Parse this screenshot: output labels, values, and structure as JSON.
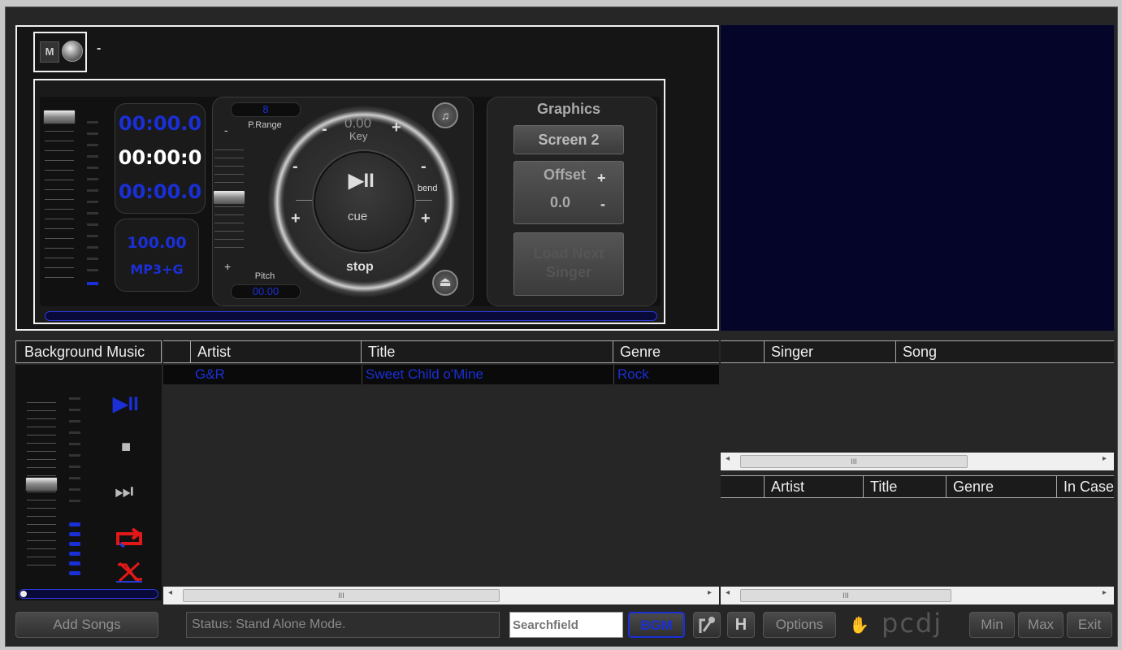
{
  "deck": {
    "mode_label": "M",
    "track_label": "-",
    "time_remaining": "00:00.0",
    "time_elapsed": "00:00:0",
    "time_total": "00:00.0",
    "tempo_value": "100.00",
    "format": "MP3+G",
    "p_range_value": "8",
    "p_range_label": "P.Range",
    "pitch_label": "Pitch",
    "pitch_value": "00.00",
    "minus_sign": "-",
    "plus_sign": "+",
    "key_value": "0.00",
    "key_label": "Key",
    "bend_label": "bend",
    "cue_label": "cue",
    "stop_label": "stop",
    "play_pause_glyph": "▶II",
    "eject_glyph": "⏏",
    "graphics_label": "Graphics",
    "screen_button": "Screen 2",
    "offset_label": "Offset",
    "offset_value": "0.0",
    "load_next_line1": "Load Next",
    "load_next_line2": "Singer"
  },
  "bgm": {
    "title": "Background Music",
    "play_glyph": "▶II",
    "stop_glyph": "■",
    "next_glyph": "⏭",
    "columns": [
      "",
      "Artist",
      "Title",
      "Genre"
    ],
    "rows": [
      {
        "artist": "G&R",
        "title": "Sweet Child o'Mine",
        "genre": "Rock"
      }
    ]
  },
  "singer_list": {
    "columns": [
      "",
      "Singer",
      "Song"
    ]
  },
  "song_list": {
    "columns": [
      "",
      "Artist",
      "Title",
      "Genre",
      "In Case"
    ]
  },
  "scrollbar_grip": "III",
  "scroll_left": "◂",
  "scroll_right": "▸",
  "bottom_bar": {
    "add_songs": "Add Songs",
    "status": "Status: Stand Alone Mode.",
    "search_placeholder": "Searchfield",
    "bgm_button": "BGM",
    "h_button": "H",
    "options_button": "Options",
    "logo_text": "pcdj",
    "min_button": "Min",
    "max_button": "Max",
    "exit_button": "Exit"
  },
  "colors": {
    "accent_blue": "#1a2fd6",
    "video_bg": "#05052a",
    "app_bg": "#262626"
  }
}
